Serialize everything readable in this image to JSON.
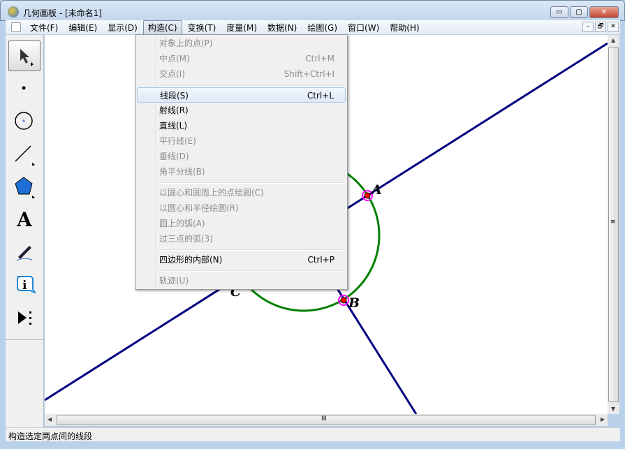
{
  "window": {
    "title": "几何画板 - [未命名1]",
    "minimize": "▭",
    "maximize": "▢",
    "close": "✕"
  },
  "menubar": [
    "文件(F)",
    "编辑(E)",
    "显示(D)",
    "构造(C)",
    "变换(T)",
    "度量(M)",
    "数据(N)",
    "绘图(G)",
    "窗口(W)",
    "帮助(H)"
  ],
  "mdi": [
    "–",
    "🗗",
    "✕"
  ],
  "construct_menu": [
    {
      "label": "对象上的点(P)",
      "shortcut": "",
      "enabled": false
    },
    {
      "label": "中点(M)",
      "shortcut": "Ctrl+M",
      "enabled": false
    },
    {
      "label": "交点(I)",
      "shortcut": "Shift+Ctrl+I",
      "enabled": false
    },
    {
      "label": "线段(S)",
      "shortcut": "Ctrl+L",
      "enabled": true,
      "highlighted": true
    },
    {
      "label": "射线(R)",
      "shortcut": "",
      "enabled": true
    },
    {
      "label": "直线(L)",
      "shortcut": "",
      "enabled": true
    },
    {
      "label": "平行线(E)",
      "shortcut": "",
      "enabled": false
    },
    {
      "label": "垂线(D)",
      "shortcut": "",
      "enabled": false
    },
    {
      "label": "角平分线(B)",
      "shortcut": "",
      "enabled": false
    },
    {
      "label": "以圆心和圆周上的点绘圆(C)",
      "shortcut": "",
      "enabled": false
    },
    {
      "label": "以圆心和半径绘圆(R)",
      "shortcut": "",
      "enabled": false
    },
    {
      "label": "圆上的弧(A)",
      "shortcut": "",
      "enabled": false
    },
    {
      "label": "过三点的弧(3)",
      "shortcut": "",
      "enabled": false
    },
    {
      "label": "四边形的内部(N)",
      "shortcut": "Ctrl+P",
      "enabled": true
    },
    {
      "label": "轨迹(U)",
      "shortcut": "",
      "enabled": false
    }
  ],
  "tools": [
    "arrow-tool",
    "point-tool",
    "compass-tool",
    "straightedge-tool",
    "polygon-tool",
    "text-tool",
    "marker-tool",
    "information-tool",
    "custom-tool"
  ],
  "text_tool_glyph": "A",
  "info_tool_glyph": "i",
  "points": {
    "A": "A",
    "B": "B",
    "C": "C"
  },
  "colors": {
    "line": "#000080",
    "circle": "#008000",
    "point": "#ff0000",
    "selection": "#ff00ff"
  },
  "hscroll_grip": "III",
  "vscroll_grip": "≡",
  "status": "构造选定两点间的线段"
}
